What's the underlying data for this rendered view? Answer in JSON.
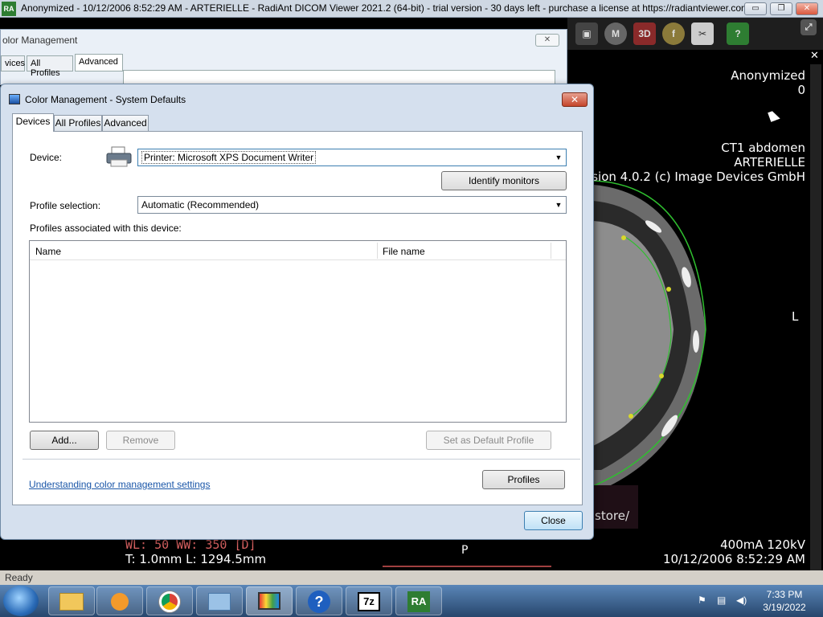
{
  "app": {
    "title": "Anonymized - 10/12/2006 8:52:29 AM - ARTERIELLE - RadiAnt DICOM Viewer 2021.2 (64-bit) - trial version - 30 days left - purchase a license at https://radiantviewer.com...",
    "logo": "RA",
    "minimize": "▭",
    "maximize": "❐",
    "close": "✕"
  },
  "viewer": {
    "overlay_top_right": [
      "Anonymized",
      "0"
    ],
    "study": "CT1 abdomen",
    "series": "ARTERIELLE",
    "version_text": "sion 4.0.2 (c) Image Devices GmbH",
    "orientation_right": "L",
    "orientation_bottom": "P",
    "wl": "WL: 50 WW: 350 [D]",
    "thickness": "T: 1.0mm L: 1294.5mm",
    "exposure": "400mA 120kV",
    "datetime": "10/12/2006 8:52:29 AM",
    "partial_text": "store/",
    "close_icon": "✕"
  },
  "bg_window": {
    "title": "olor Management",
    "tabs": [
      "vices",
      "All Profiles",
      "Advanced"
    ],
    "close": "✕"
  },
  "dialog": {
    "title": "Color Management - System Defaults",
    "close": "✕",
    "tabs": [
      "Devices",
      "All Profiles",
      "Advanced"
    ],
    "device_label": "Device:",
    "device_value": "Printer: Microsoft XPS Document Writer",
    "identify_button": "Identify monitors",
    "profile_selection_label": "Profile selection:",
    "profile_selection_value": "Automatic (Recommended)",
    "profiles_associated_label": "Profiles associated with this device:",
    "columns": [
      "Name",
      "File name"
    ],
    "add_button": "Add...",
    "remove_button": "Remove",
    "set_default_button": "Set as Default Profile",
    "link": "Understanding color management settings",
    "profiles_button": "Profiles",
    "close_button": "Close"
  },
  "status": {
    "text": "Ready"
  },
  "taskbar": {
    "items": [
      "explorer",
      "media-player",
      "chrome",
      "control-panel",
      "color-management",
      "help",
      "7zip",
      "radiant"
    ],
    "time": "7:33 PM",
    "date": "3/19/2022"
  }
}
